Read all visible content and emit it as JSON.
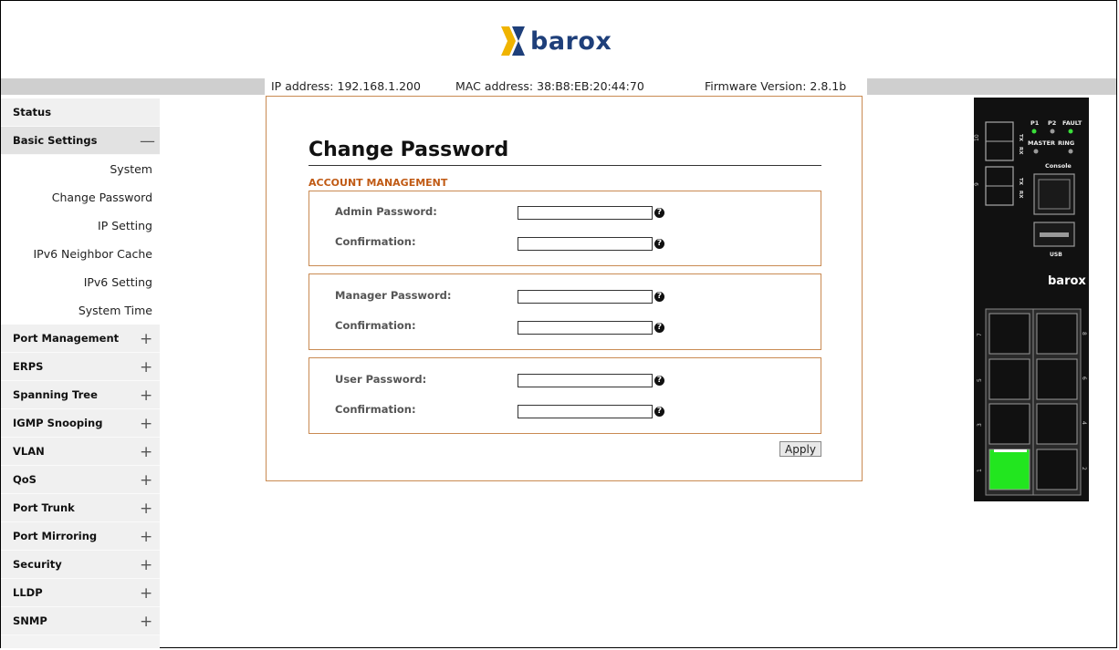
{
  "header": {
    "brand": "barox"
  },
  "infobar": {
    "ip": "IP address: 192.168.1.200",
    "mac": "MAC address: 38:B8:EB:20:44:70",
    "firmware": "Firmware Version: 2.8.1b"
  },
  "sidebar": {
    "items": [
      {
        "label": "Status",
        "symbol": ""
      },
      {
        "label": "Basic Settings",
        "symbol": "—"
      },
      {
        "label": "System",
        "sub": true
      },
      {
        "label": "Change Password",
        "sub": true
      },
      {
        "label": "IP Setting",
        "sub": true
      },
      {
        "label": "IPv6 Neighbor Cache",
        "sub": true
      },
      {
        "label": "IPv6 Setting",
        "sub": true
      },
      {
        "label": "System Time",
        "sub": true
      },
      {
        "label": "Port Management",
        "symbol": "+"
      },
      {
        "label": "ERPS",
        "symbol": "+"
      },
      {
        "label": "Spanning Tree",
        "symbol": "+"
      },
      {
        "label": "IGMP Snooping",
        "symbol": "+"
      },
      {
        "label": "VLAN",
        "symbol": "+"
      },
      {
        "label": "QoS",
        "symbol": "+"
      },
      {
        "label": "Port Trunk",
        "symbol": "+"
      },
      {
        "label": "Port Mirroring",
        "symbol": "+"
      },
      {
        "label": "Security",
        "symbol": "+"
      },
      {
        "label": "LLDP",
        "symbol": "+"
      },
      {
        "label": "SNMP",
        "symbol": "+"
      }
    ]
  },
  "main": {
    "title": "Change Password",
    "section": "ACCOUNT MANAGEMENT",
    "admin_label": "Admin Password:",
    "admin_confirm_label": "Confirmation:",
    "manager_label": "Manager Password:",
    "manager_confirm_label": "Confirmation:",
    "user_label": "User Password:",
    "user_confirm_label": "Confirmation:",
    "help_glyph": "?",
    "apply_label": "Apply"
  },
  "device": {
    "labels": {
      "p1": "P1",
      "p2": "P2",
      "fault": "FAULT",
      "master": "MASTER",
      "ring": "RING",
      "console": "Console",
      "usb": "USB",
      "brand": "barox",
      "tx": "TX",
      "rx": "RX",
      "sfp_top": "10",
      "sfp_bottom": "9",
      "ports": [
        "7",
        "8",
        "5",
        "6",
        "3",
        "4",
        "1",
        "2"
      ]
    },
    "led_color_on": "#3adf3a",
    "led_color_off": "#9a9a9a",
    "active_port_color": "#22e61f"
  }
}
